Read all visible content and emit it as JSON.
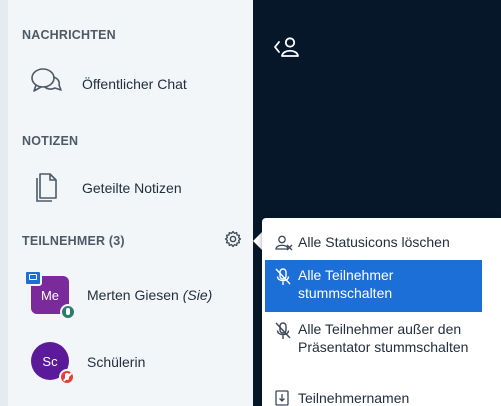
{
  "sections": {
    "messages_title": "NACHRICHTEN",
    "notes_title": "NOTIZEN",
    "participants_title": "TEILNEHMER (3)"
  },
  "items": {
    "public_chat": "Öffentlicher Chat",
    "shared_notes": "Geteilte Notizen"
  },
  "users": [
    {
      "initials": "Me",
      "name": "Merten Giesen",
      "suffix": "(Sie)",
      "color": "#7b2a9c"
    },
    {
      "initials": "Sc",
      "name": "Schülerin",
      "color": "#5b1a9a"
    }
  ],
  "menu": {
    "items": [
      {
        "label": "Alle Statusicons löschen",
        "icon": "clear-status-icon"
      },
      {
        "label": "Alle Teilnehmer stummschalten",
        "icon": "mute-icon"
      },
      {
        "label": "Alle Teilnehmer außer den Präsentator stummschalten",
        "icon": "mute-icon"
      },
      {
        "label": "Teilnehmernamen",
        "icon": "download-icon"
      }
    ]
  },
  "colors": {
    "sidebar": "#f3f6f9",
    "main_area": "#06172a",
    "selected_item": "#1b6fd6",
    "presenter_badge": "#2e7d6a",
    "muted_badge": "#e0413a"
  }
}
